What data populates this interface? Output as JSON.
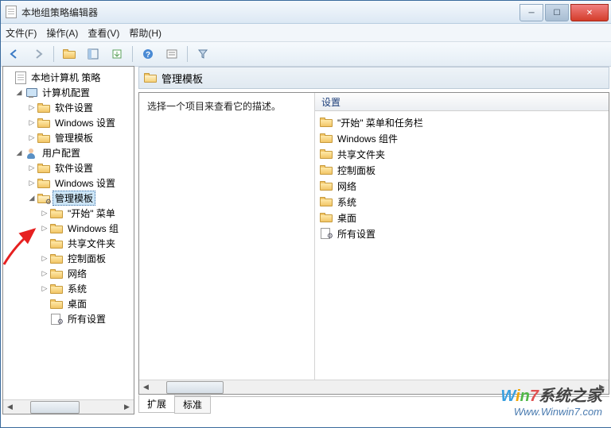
{
  "window": {
    "title": "本地组策略编辑器"
  },
  "menu": {
    "file": "文件(F)",
    "action": "操作(A)",
    "view": "查看(V)",
    "help": "帮助(H)"
  },
  "tree": {
    "root": "本地计算机 策略",
    "computer": "计算机配置",
    "user": "用户配置",
    "software": "软件设置",
    "windows_settings": "Windows 设置",
    "admin_templates": "管理模板",
    "start_menu": "\"开始\" 菜单",
    "windows_components": "Windows 组",
    "shared_folders": "共享文件夹",
    "control_panel": "控制面板",
    "network": "网络",
    "system": "系统",
    "desktop": "桌面",
    "all_settings": "所有设置"
  },
  "header": {
    "title": "管理模板"
  },
  "desc": {
    "prompt": "选择一个项目来查看它的描述。"
  },
  "list": {
    "col_setting": "设置",
    "items": [
      "\"开始\" 菜单和任务栏",
      "Windows 组件",
      "共享文件夹",
      "控制面板",
      "网络",
      "系统",
      "桌面",
      "所有设置"
    ]
  },
  "tabs": {
    "extended": "扩展",
    "standard": "标准"
  },
  "watermark": {
    "line1": "Win7系统之家",
    "line2": "Www.Winwin7.com"
  }
}
